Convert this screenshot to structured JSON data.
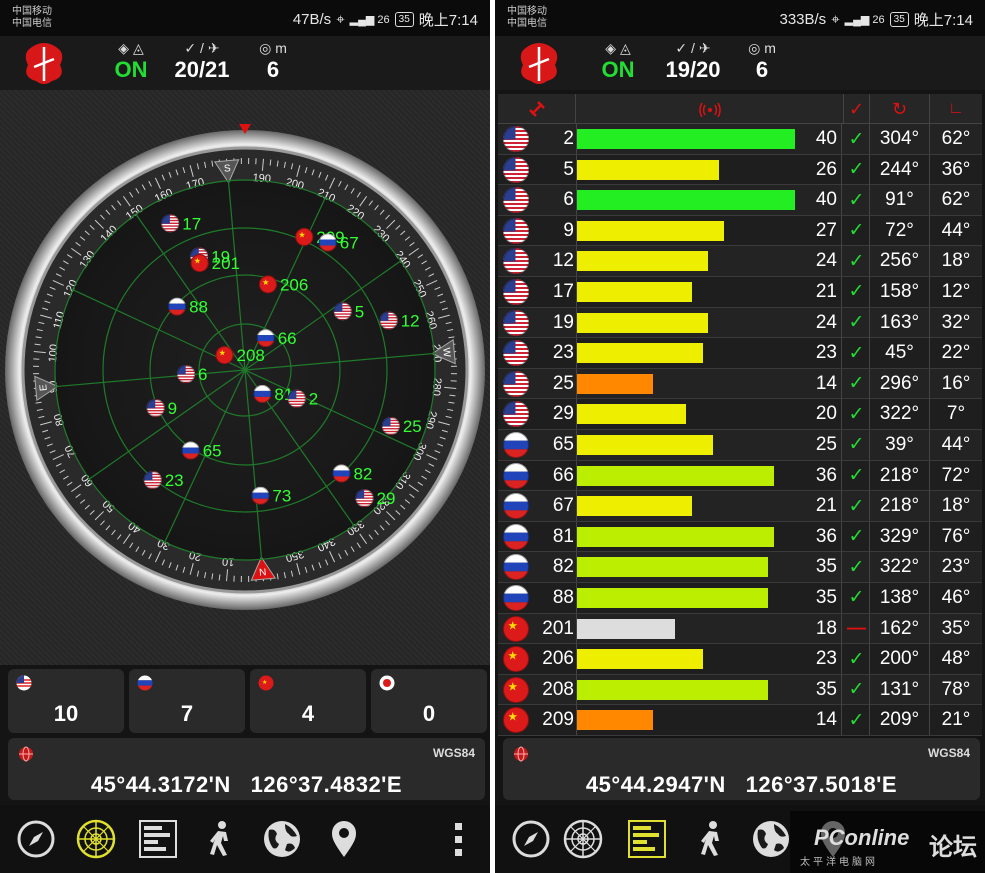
{
  "left": {
    "status": {
      "carrier1": "中国移动",
      "carrier2": "中国电信",
      "net_speed": "47B/s",
      "signal": "26",
      "battery": "35",
      "time": "晚上7:14"
    },
    "header": {
      "fix_status": "ON",
      "sats_ratio": "20/21",
      "accuracy_unit": "m",
      "accuracy": "6"
    },
    "counts": [
      {
        "flag": "usa",
        "value": "10"
      },
      {
        "flag": "russia",
        "value": "7"
      },
      {
        "flag": "china",
        "value": "4"
      },
      {
        "flag": "other",
        "value": "0"
      }
    ],
    "position": {
      "datum": "WGS84",
      "lat": "45°44.3172'N",
      "lon": "126°37.4832'E"
    },
    "compass": {
      "cardinals": [
        "N",
        "E",
        "S",
        "W"
      ],
      "ticks": [
        "10",
        "20",
        "30",
        "40",
        "50",
        "60",
        "70",
        "80",
        "90",
        "100",
        "110",
        "120",
        "130",
        "140",
        "150",
        "160",
        "170",
        "190",
        "200",
        "210",
        "220",
        "230",
        "240",
        "250",
        "260",
        "270",
        "280",
        "290",
        "300",
        "310",
        "320",
        "330",
        "340",
        "350"
      ]
    },
    "satellites": [
      {
        "id": "17",
        "flag": "usa",
        "azimuth": 158,
        "elevation": 12
      },
      {
        "id": "19",
        "flag": "usa",
        "azimuth": 163,
        "elevation": 32
      },
      {
        "id": "201",
        "flag": "china",
        "azimuth": 162,
        "elevation": 35
      },
      {
        "id": "209",
        "flag": "china",
        "azimuth": 209,
        "elevation": 21
      },
      {
        "id": "67",
        "flag": "russia",
        "azimuth": 218,
        "elevation": 18
      },
      {
        "id": "88",
        "flag": "russia",
        "azimuth": 138,
        "elevation": 46
      },
      {
        "id": "206",
        "flag": "china",
        "azimuth": 200,
        "elevation": 48
      },
      {
        "id": "5",
        "flag": "usa",
        "azimuth": 244,
        "elevation": 36
      },
      {
        "id": "12",
        "flag": "usa",
        "azimuth": 256,
        "elevation": 18
      },
      {
        "id": "6",
        "flag": "usa",
        "azimuth": 91,
        "elevation": 62
      },
      {
        "id": "208",
        "flag": "china",
        "azimuth": 131,
        "elevation": 78
      },
      {
        "id": "66",
        "flag": "russia",
        "azimuth": 218,
        "elevation": 72
      },
      {
        "id": "9",
        "flag": "usa",
        "azimuth": 72,
        "elevation": 44
      },
      {
        "id": "81",
        "flag": "russia",
        "azimuth": 329,
        "elevation": 76
      },
      {
        "id": "2",
        "flag": "usa",
        "azimuth": 304,
        "elevation": 62
      },
      {
        "id": "65",
        "flag": "russia",
        "azimuth": 39,
        "elevation": 44
      },
      {
        "id": "23",
        "flag": "usa",
        "azimuth": 45,
        "elevation": 22
      },
      {
        "id": "25",
        "flag": "usa",
        "azimuth": 296,
        "elevation": 16
      },
      {
        "id": "82",
        "flag": "russia",
        "azimuth": 322,
        "elevation": 23
      },
      {
        "id": "29",
        "flag": "usa",
        "azimuth": 322,
        "elevation": 7
      },
      {
        "id": "73",
        "flag": "russia",
        "azimuth": 358,
        "elevation": 30
      }
    ]
  },
  "right": {
    "status": {
      "carrier1": "中国移动",
      "carrier2": "中国电信",
      "net_speed": "333B/s",
      "signal": "26",
      "battery": "35",
      "time": "晚上7:14"
    },
    "header": {
      "fix_status": "ON",
      "sats_ratio": "19/20",
      "accuracy_unit": "m",
      "accuracy": "6"
    },
    "position": {
      "datum": "WGS84",
      "lat": "45°44.2947'N",
      "lon": "126°37.5018'E"
    },
    "rows": [
      {
        "flag": "usa",
        "prn": "2",
        "snr": "40",
        "used": true,
        "azimuth": "304°",
        "elevation": "62°",
        "color": "#22ee22"
      },
      {
        "flag": "usa",
        "prn": "5",
        "snr": "26",
        "used": true,
        "azimuth": "244°",
        "elevation": "36°",
        "color": "#eeee00"
      },
      {
        "flag": "usa",
        "prn": "6",
        "snr": "40",
        "used": true,
        "azimuth": "91°",
        "elevation": "62°",
        "color": "#22ee22"
      },
      {
        "flag": "usa",
        "prn": "9",
        "snr": "27",
        "used": true,
        "azimuth": "72°",
        "elevation": "44°",
        "color": "#eeee00"
      },
      {
        "flag": "usa",
        "prn": "12",
        "snr": "24",
        "used": true,
        "azimuth": "256°",
        "elevation": "18°",
        "color": "#eeee00"
      },
      {
        "flag": "usa",
        "prn": "17",
        "snr": "21",
        "used": true,
        "azimuth": "158°",
        "elevation": "12°",
        "color": "#eeee00"
      },
      {
        "flag": "usa",
        "prn": "19",
        "snr": "24",
        "used": true,
        "azimuth": "163°",
        "elevation": "32°",
        "color": "#eeee00"
      },
      {
        "flag": "usa",
        "prn": "23",
        "snr": "23",
        "used": true,
        "azimuth": "45°",
        "elevation": "22°",
        "color": "#eeee00"
      },
      {
        "flag": "usa",
        "prn": "25",
        "snr": "14",
        "used": true,
        "azimuth": "296°",
        "elevation": "16°",
        "color": "#ff8800"
      },
      {
        "flag": "usa",
        "prn": "29",
        "snr": "20",
        "used": true,
        "azimuth": "322°",
        "elevation": "7°",
        "color": "#eeee00"
      },
      {
        "flag": "russia",
        "prn": "65",
        "snr": "25",
        "used": true,
        "azimuth": "39°",
        "elevation": "44°",
        "color": "#eeee00"
      },
      {
        "flag": "russia",
        "prn": "66",
        "snr": "36",
        "used": true,
        "azimuth": "218°",
        "elevation": "72°",
        "color": "#bbee00"
      },
      {
        "flag": "russia",
        "prn": "67",
        "snr": "21",
        "used": true,
        "azimuth": "218°",
        "elevation": "18°",
        "color": "#eeee00"
      },
      {
        "flag": "russia",
        "prn": "81",
        "snr": "36",
        "used": true,
        "azimuth": "329°",
        "elevation": "76°",
        "color": "#bbee00"
      },
      {
        "flag": "russia",
        "prn": "82",
        "snr": "35",
        "used": true,
        "azimuth": "322°",
        "elevation": "23°",
        "color": "#bbee00"
      },
      {
        "flag": "russia",
        "prn": "88",
        "snr": "35",
        "used": true,
        "azimuth": "138°",
        "elevation": "46°",
        "color": "#bbee00"
      },
      {
        "flag": "china",
        "prn": "201",
        "snr": "18",
        "used": false,
        "azimuth": "162°",
        "elevation": "35°",
        "color": "#dddddd"
      },
      {
        "flag": "china",
        "prn": "206",
        "snr": "23",
        "used": true,
        "azimuth": "200°",
        "elevation": "48°",
        "color": "#eeee00"
      },
      {
        "flag": "china",
        "prn": "208",
        "snr": "35",
        "used": true,
        "azimuth": "131°",
        "elevation": "78°",
        "color": "#bbee00"
      },
      {
        "flag": "china",
        "prn": "209",
        "snr": "14",
        "used": true,
        "azimuth": "209°",
        "elevation": "21°",
        "color": "#ff8800"
      }
    ],
    "snr_max": 48
  },
  "watermark": {
    "brand": "PConline",
    "sub": "太平洋电脑网",
    "forum": "论坛"
  },
  "colors": {
    "accent_green": "#22dd33",
    "label_green": "#33ff33",
    "warning_red": "#dd1111"
  },
  "icons": [
    "compass-icon",
    "radar-icon",
    "signal-bars-icon",
    "walking-icon",
    "globe-icon",
    "map-pin-icon",
    "more-vert-icon"
  ]
}
